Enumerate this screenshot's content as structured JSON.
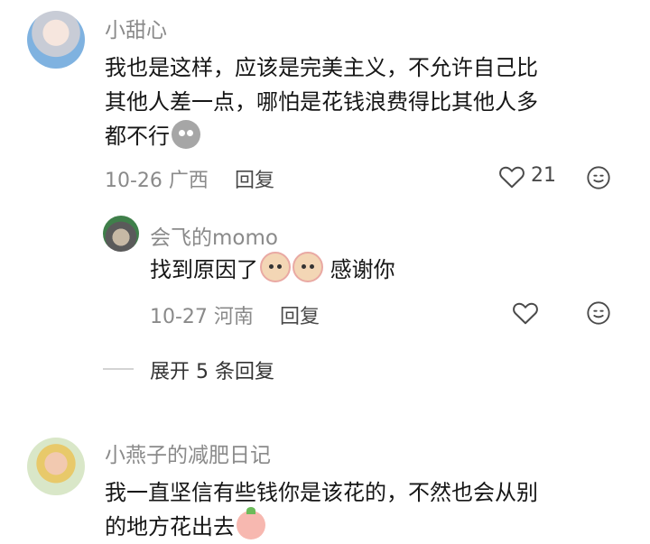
{
  "comments": [
    {
      "username": "小甜心",
      "text_line1": "我也是这样，应该是完美主义，不允许自己比",
      "text_line2": "其他人差一点，哪怕是花钱浪费得比其他人多",
      "text_line3": "都不行",
      "date_location": "10-26 广西",
      "reply_label": "回复",
      "like_count": "21"
    },
    {
      "username": "会飞的momo",
      "text": "找到原因了",
      "text_after": "感谢你",
      "date_location": "10-27 河南",
      "reply_label": "回复"
    },
    {
      "username": "小燕子的减肥日记",
      "text_line1": "我一直坚信有些钱你是该花的，不然也会从别",
      "text_line2": "的地方花出去"
    }
  ],
  "expand_replies": "展开 5 条回复",
  "icons": {
    "heart": "heart-outline-icon",
    "emoji": "smile-face-icon"
  }
}
